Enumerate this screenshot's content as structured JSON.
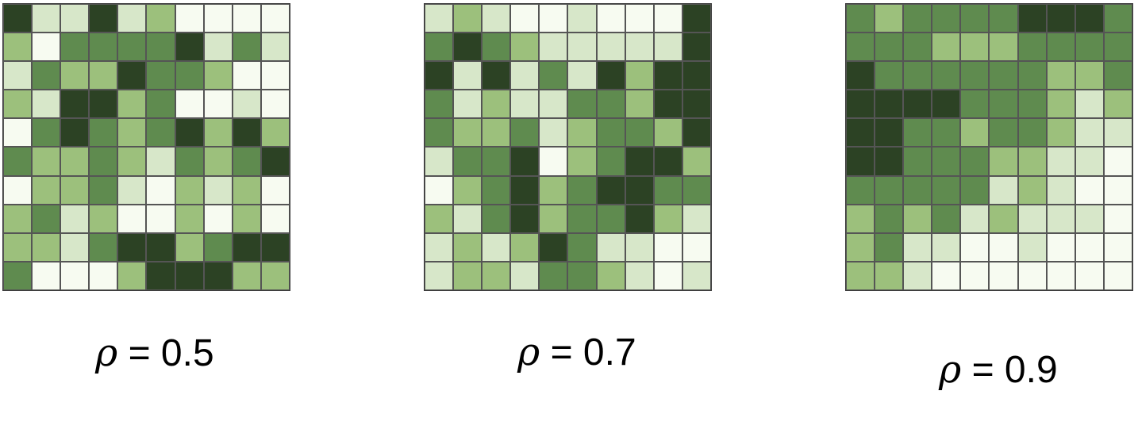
{
  "palette": [
    "#f7fbf1",
    "#d7e7c9",
    "#9cc07c",
    "#5f8b4f",
    "#2c4224"
  ],
  "chart_data": [
    {
      "type": "heatmap",
      "title": "ρ = 0.5",
      "symbol": "ρ",
      "rho_text": "= 0.5",
      "rows": 10,
      "cols": 10,
      "levels": [
        [
          4,
          1,
          1,
          4,
          1,
          2,
          0,
          0,
          0,
          0
        ],
        [
          2,
          0,
          3,
          3,
          3,
          3,
          4,
          1,
          3,
          1
        ],
        [
          1,
          3,
          2,
          2,
          4,
          3,
          3,
          2,
          0,
          0
        ],
        [
          2,
          1,
          4,
          4,
          2,
          3,
          0,
          0,
          1,
          0
        ],
        [
          0,
          3,
          4,
          3,
          2,
          3,
          4,
          2,
          4,
          2
        ],
        [
          3,
          2,
          2,
          3,
          2,
          1,
          3,
          2,
          3,
          4
        ],
        [
          0,
          2,
          2,
          3,
          1,
          0,
          2,
          1,
          2,
          0
        ],
        [
          2,
          3,
          1,
          2,
          0,
          0,
          2,
          0,
          2,
          0
        ],
        [
          2,
          2,
          1,
          3,
          4,
          4,
          2,
          3,
          4,
          4
        ],
        [
          3,
          0,
          0,
          0,
          2,
          4,
          4,
          4,
          2,
          2
        ]
      ]
    },
    {
      "type": "heatmap",
      "title": "ρ = 0.7",
      "symbol": "ρ",
      "rho_text": "= 0.7",
      "rows": 10,
      "cols": 10,
      "levels": [
        [
          1,
          2,
          1,
          0,
          0,
          1,
          0,
          0,
          0,
          4
        ],
        [
          3,
          4,
          3,
          2,
          1,
          1,
          1,
          1,
          1,
          4
        ],
        [
          4,
          1,
          4,
          1,
          3,
          1,
          4,
          2,
          4,
          4
        ],
        [
          3,
          1,
          2,
          1,
          1,
          3,
          3,
          2,
          4,
          4
        ],
        [
          3,
          2,
          2,
          3,
          1,
          2,
          3,
          3,
          2,
          4
        ],
        [
          1,
          3,
          3,
          4,
          0,
          2,
          3,
          4,
          4,
          2
        ],
        [
          0,
          2,
          3,
          4,
          2,
          3,
          4,
          4,
          3,
          3
        ],
        [
          2,
          1,
          3,
          4,
          2,
          3,
          3,
          4,
          2,
          1
        ],
        [
          1,
          2,
          1,
          2,
          4,
          3,
          1,
          1,
          0,
          0
        ],
        [
          1,
          2,
          2,
          1,
          3,
          3,
          2,
          1,
          0,
          1
        ]
      ]
    },
    {
      "type": "heatmap",
      "title": "ρ = 0.9",
      "symbol": "ρ",
      "rho_text": "= 0.9",
      "rows": 10,
      "cols": 10,
      "levels": [
        [
          3,
          2,
          3,
          3,
          3,
          3,
          4,
          4,
          4,
          3
        ],
        [
          3,
          3,
          3,
          2,
          2,
          2,
          3,
          3,
          3,
          3
        ],
        [
          4,
          3,
          3,
          3,
          3,
          3,
          3,
          2,
          2,
          3
        ],
        [
          4,
          4,
          4,
          4,
          3,
          3,
          3,
          2,
          1,
          2
        ],
        [
          4,
          4,
          3,
          3,
          2,
          3,
          3,
          2,
          1,
          1
        ],
        [
          4,
          4,
          3,
          3,
          3,
          2,
          2,
          1,
          1,
          0
        ],
        [
          3,
          3,
          3,
          3,
          3,
          1,
          2,
          1,
          0,
          0
        ],
        [
          2,
          3,
          2,
          3,
          1,
          2,
          1,
          1,
          1,
          0
        ],
        [
          2,
          3,
          1,
          1,
          0,
          0,
          1,
          0,
          0,
          0
        ],
        [
          2,
          2,
          1,
          0,
          0,
          0,
          0,
          0,
          0,
          0
        ]
      ]
    }
  ]
}
